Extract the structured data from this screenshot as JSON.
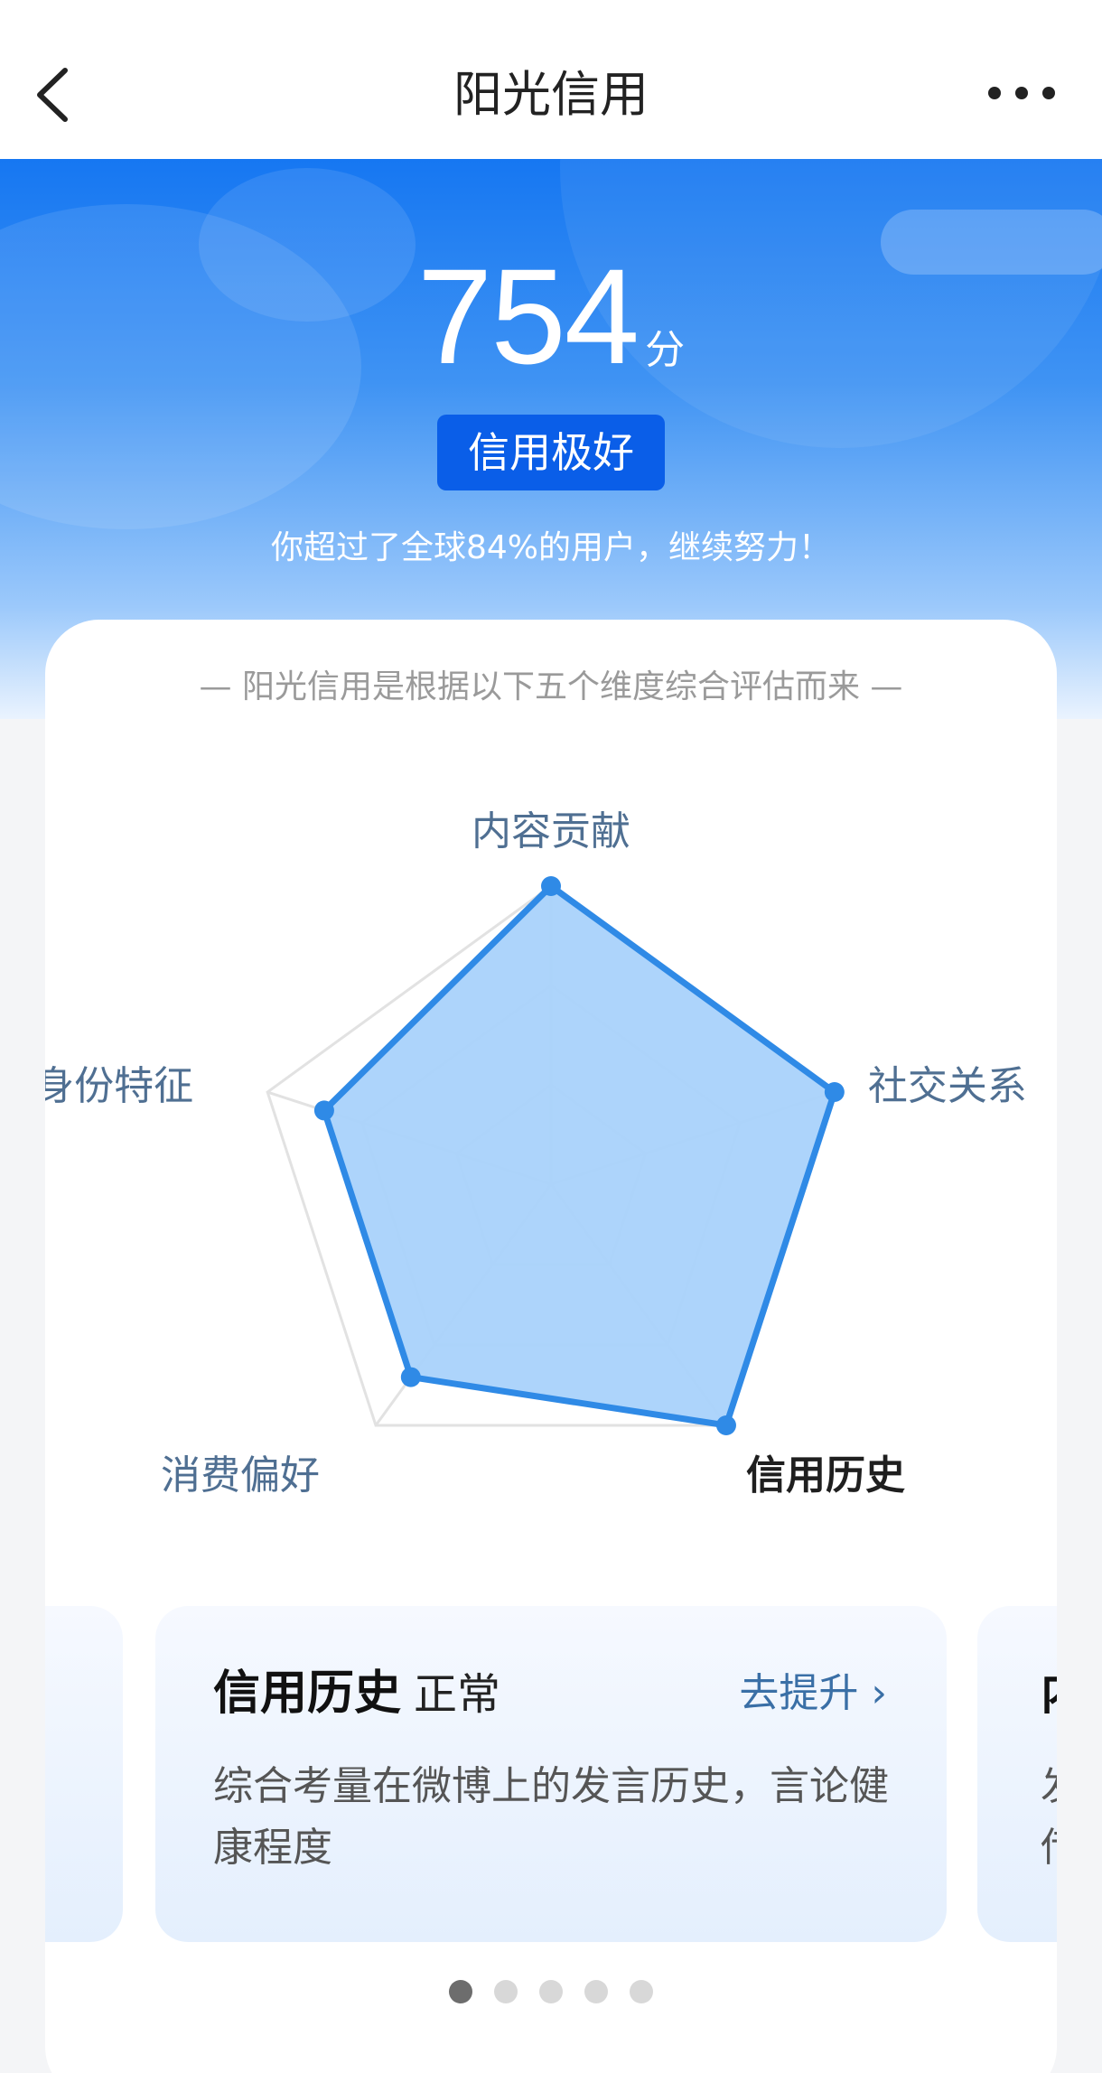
{
  "nav": {
    "title": "阳光信用",
    "back_icon": "chevron-left-icon",
    "more_icon": "more-dots-icon"
  },
  "score": {
    "value": "754",
    "unit": "分",
    "level": "信用极好",
    "rank_text": "你超过了全球84%的用户，继续努力！"
  },
  "card": {
    "subtitle": "— 阳光信用是根据以下五个维度综合评估而来 —",
    "dimensions": [
      {
        "label": "内容贡献",
        "value": 1.0,
        "active": false
      },
      {
        "label": "社交关系",
        "value": 1.0,
        "active": false
      },
      {
        "label": "信用历史",
        "value": 1.0,
        "active": true
      },
      {
        "label": "消费偏好",
        "value": 0.8,
        "active": false
      },
      {
        "label": "身份特征",
        "value": 0.8,
        "active": false
      }
    ]
  },
  "slide": {
    "title": "信用历史",
    "status": "正常",
    "action": "去提升",
    "description": "综合考量在微博上的发言历史，言论健康程度",
    "peek_title": "内",
    "peek_desc": "发 传"
  },
  "pagination": {
    "count": 5,
    "active_index": 0
  },
  "colors": {
    "primary": "#1677f2",
    "radar_stroke": "#2f8ae6",
    "radar_fill": "#a9d2fb",
    "label": "#4f6f92"
  }
}
